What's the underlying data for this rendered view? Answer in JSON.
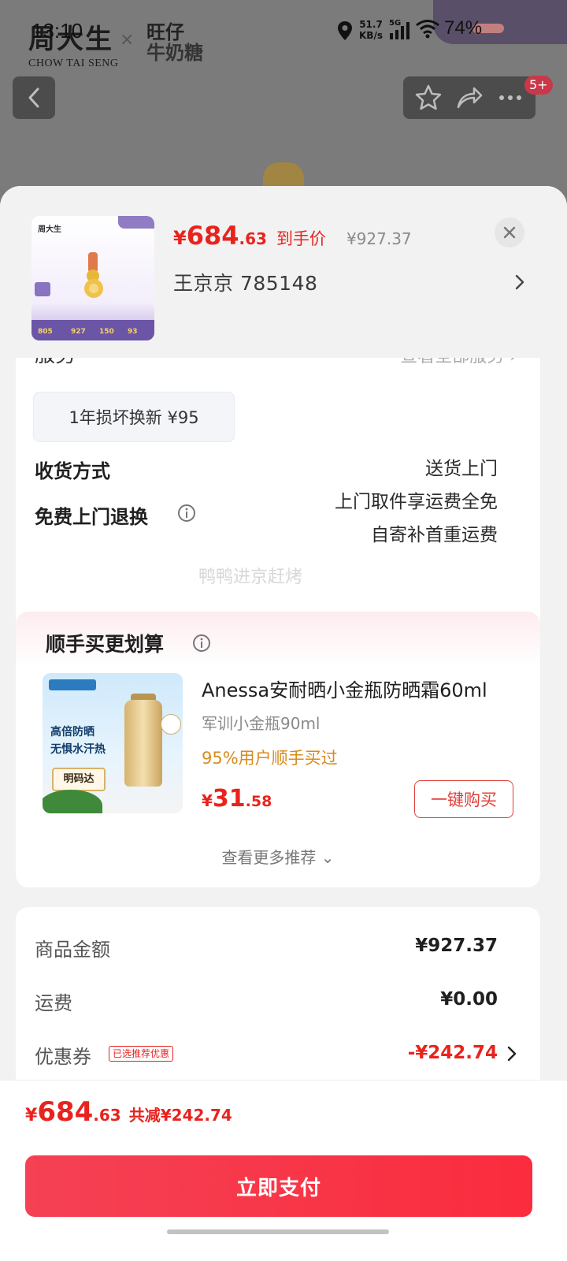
{
  "status_bar": {
    "time": "13:10",
    "net_speed_value": "51.7",
    "net_speed_unit": "KB/s",
    "network": "5G",
    "battery": "74%"
  },
  "brand": {
    "name_cn": "周大生",
    "name_en": "CHOW TAI SENG",
    "cross": "×",
    "partner_l1": "旺仔",
    "partner_l2": "牛奶糖"
  },
  "top_actions": {
    "badge": "5+"
  },
  "sheet_header": {
    "price_symbol": "¥",
    "price_int": "684",
    "price_dec": ".63",
    "price_label": "到手价",
    "original_price": "¥927.37",
    "address": "王京京  785148",
    "thumb_values": [
      "805",
      "927",
      "150",
      "93"
    ]
  },
  "service": {
    "peek_label": "服务",
    "peek_right": "查看全部服务 ›",
    "chip": "1年损坏换新  ¥95"
  },
  "delivery": {
    "label": "收货方式",
    "value": "送货上门"
  },
  "free_return": {
    "label": "免费上门退换",
    "line1": "上门取件享运费全免",
    "line2": "自寄补首重运费"
  },
  "watermark": "鸭鸭进京赶烤",
  "recommend": {
    "title": "顺手买更划算",
    "image_text": "高倍防晒\n无惧水汗热",
    "image_badge": "明码达",
    "product_name": "Anessa安耐晒小金瓶防晒霜60ml",
    "spec": "军训小金瓶90ml",
    "rate": "95%用户顺手买过",
    "price_symbol": "¥",
    "price_int": "31",
    "price_dec": ".58",
    "buy_label": "一键购买",
    "more_label": "查看更多推荐 ⌄"
  },
  "summary": {
    "goods_label": "商品金额",
    "goods_value": "¥927.37",
    "shipping_label": "运费",
    "shipping_value": "¥0.00",
    "coupon_label": "优惠券",
    "coupon_tag": "已选推荐优惠",
    "coupon_value": "-¥242.74"
  },
  "footer": {
    "symbol": "¥",
    "int": "684",
    "dec": ".63",
    "saved": "共减¥242.74",
    "pay_label": "立即支付"
  },
  "colors": {
    "accent_red": "#e8231e",
    "pay_button": "#fa2c3d",
    "rate_orange": "#d98a1e"
  }
}
